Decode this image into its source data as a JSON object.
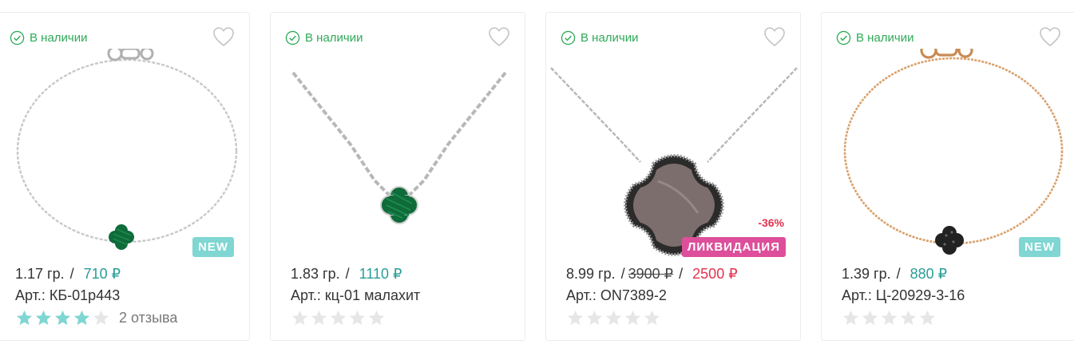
{
  "products": [
    {
      "stock": "В наличии",
      "weight": "1.17 гр.",
      "separator": "/",
      "price": "710 ₽",
      "sku": "Арт.: КБ-01р443",
      "rating": 4,
      "rating_max": 5,
      "reviews": "2 отзыва",
      "badge": "NEW",
      "image_icon": "malachite-clover-bracelet-silver",
      "colors": {
        "metal": "#c8c8c8",
        "stone": "#0f6b3a"
      }
    },
    {
      "stock": "В наличии",
      "weight": "1.83 гр.",
      "separator": "/",
      "price": "1110 ₽",
      "sku": "Арт.: кц-01 малахит",
      "rating": 0,
      "rating_max": 5,
      "image_icon": "malachite-clover-necklace-silver",
      "colors": {
        "metal": "#bdbdbd",
        "stone": "#0f6b3a"
      }
    },
    {
      "stock": "В наличии",
      "weight": "8.99 гр.",
      "separator": "/",
      "old_price": "3900 ₽",
      "separator2": "/",
      "new_price": "2500 ₽",
      "sku": "Арт.: ON7389-2",
      "rating": 0,
      "rating_max": 5,
      "discount": "-36%",
      "badge_sale": "ЛИКВИДАЦИЯ",
      "image_icon": "mother-of-pearl-pendant-silver",
      "colors": {
        "metal": "#9a9a9a",
        "stone": "#7c6e6c"
      }
    },
    {
      "stock": "В наличии",
      "weight": "1.39 гр.",
      "separator": "/",
      "price": "880 ₽",
      "sku": "Арт.: Ц-20929-3-16",
      "rating": 0,
      "rating_max": 5,
      "badge": "NEW",
      "image_icon": "black-clover-bracelet-gold",
      "colors": {
        "metal": "#d9a06a",
        "stone": "#222222"
      }
    }
  ],
  "colors": {
    "in_stock": "#2faa58",
    "price": "#2a9d97",
    "sale_price": "#e0334f",
    "badge_new": "#7fd6d2",
    "badge_sale": "#dd4f9a",
    "star_filled": "#7fd6d2",
    "star_empty": "#e6e6e6"
  }
}
